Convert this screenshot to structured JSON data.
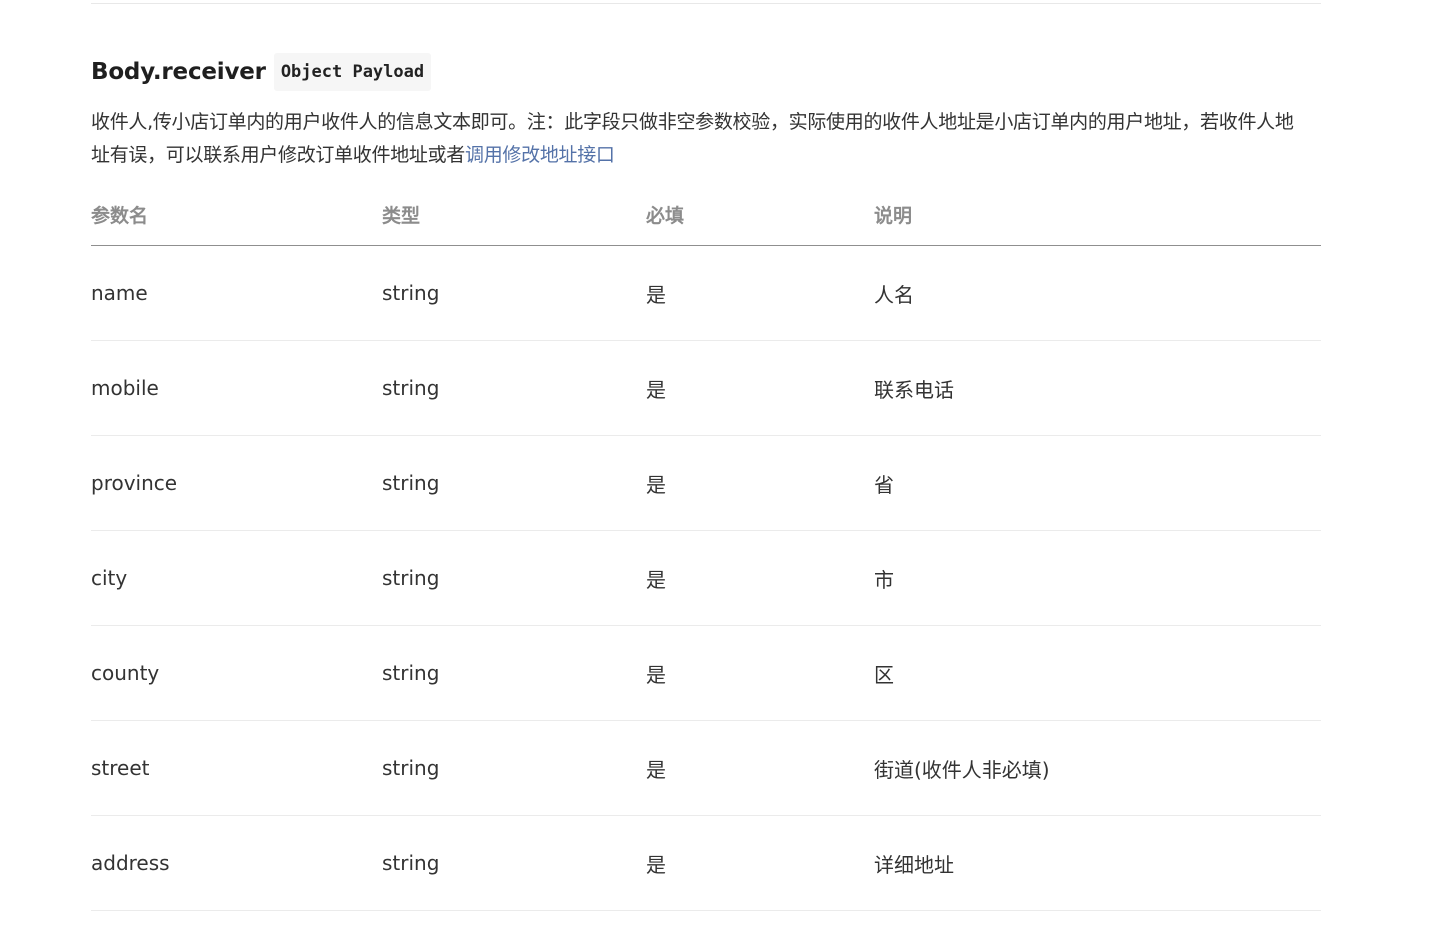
{
  "section": {
    "title": "Body.receiver",
    "badge": "Object Payload",
    "description_text": "收件人,传小店订单内的用户收件人的信息文本即可。注：此字段只做非空参数校验，实际使用的收件人地址是小店订单内的用户地址，若收件人地址有误，可以联系用户修改订单收件地址或者",
    "description_link": "调用修改地址接口"
  },
  "table": {
    "headers": [
      "参数名",
      "类型",
      "必填",
      "说明"
    ],
    "rows": [
      {
        "name": "name",
        "type": "string",
        "required": "是",
        "desc": "人名"
      },
      {
        "name": "mobile",
        "type": "string",
        "required": "是",
        "desc": "联系电话"
      },
      {
        "name": "province",
        "type": "string",
        "required": "是",
        "desc": "省"
      },
      {
        "name": "city",
        "type": "string",
        "required": "是",
        "desc": "市"
      },
      {
        "name": "county",
        "type": "string",
        "required": "是",
        "desc": "区"
      },
      {
        "name": "street",
        "type": "string",
        "required": "是",
        "desc": "街道(收件人非必填)"
      },
      {
        "name": "address",
        "type": "string",
        "required": "是",
        "desc": "详细地址"
      }
    ]
  },
  "colors": {
    "link": "#5472a8",
    "header_text": "#8c8c8c",
    "body_text": "#333333"
  }
}
